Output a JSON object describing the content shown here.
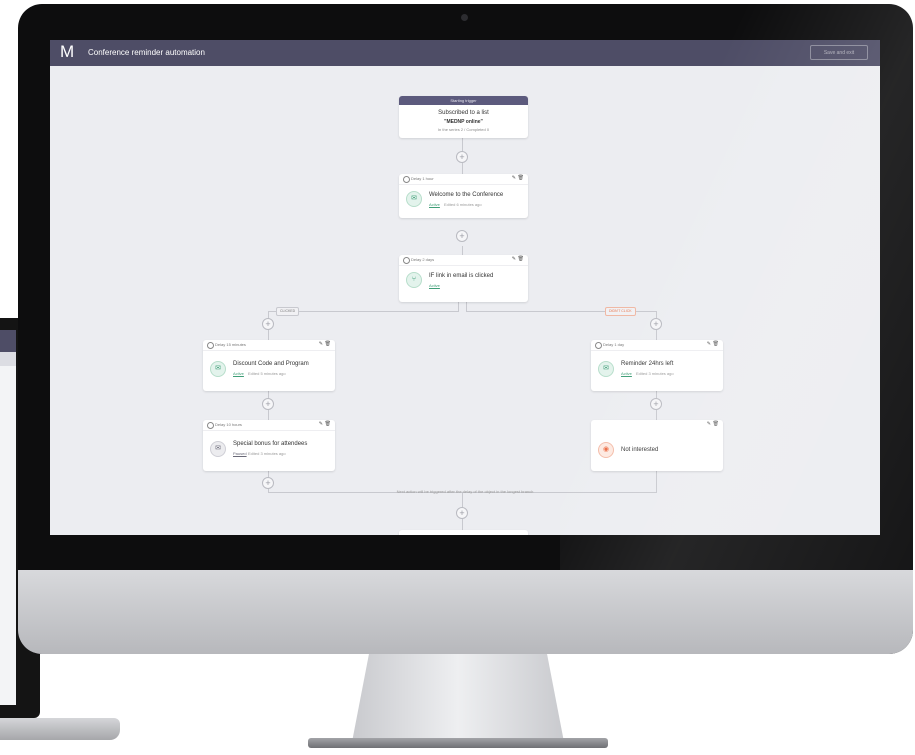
{
  "app": {
    "logo": "M",
    "title": "Conference reminder automation",
    "save_button": "Save and exit"
  },
  "trigger": {
    "header": "Starting trigger",
    "title": "Subscribed to a list",
    "list_name": "\"MEDNP online\"",
    "meta": "In the series 2 / Completed 0"
  },
  "steps": {
    "welcome": {
      "delay": "Delay 1 hour",
      "title": "Welcome to the Conference",
      "status": "Active",
      "meta": "Edited 6 minutes ago",
      "icon": "envelope-icon"
    },
    "condition": {
      "delay": "Delay 2 days",
      "title": "IF link in email is clicked",
      "status": "Active",
      "icon": "split-icon"
    },
    "discount": {
      "delay": "Delay 15 minutes",
      "title": "Discount Code and Program",
      "status": "Active",
      "meta": "Edited 5 minutes ago",
      "icon": "envelope-icon"
    },
    "bonus": {
      "delay": "Delay 10 hours",
      "title": "Special bonus for attendees",
      "status": "Paused",
      "meta": "Edited 3 minutes ago",
      "icon": "envelope-icon"
    },
    "reminder": {
      "delay": "Delay 1 day",
      "title": "Reminder 24hrs left",
      "status": "Active",
      "meta": "Edited 3 minutes ago",
      "icon": "envelope-icon"
    },
    "not_interested": {
      "title": "Not interested",
      "icon": "stop-icon"
    }
  },
  "branches": {
    "left": "CLICKED",
    "right": "DIDN'T CLICK"
  },
  "footer_note": "Next action will be triggered after the delay of the object in the longest branch",
  "colors": {
    "topbar": "#4e4d66",
    "active": "#3f9e77",
    "not_clicked": "#e8774f",
    "canvas": "#ecedf1"
  }
}
